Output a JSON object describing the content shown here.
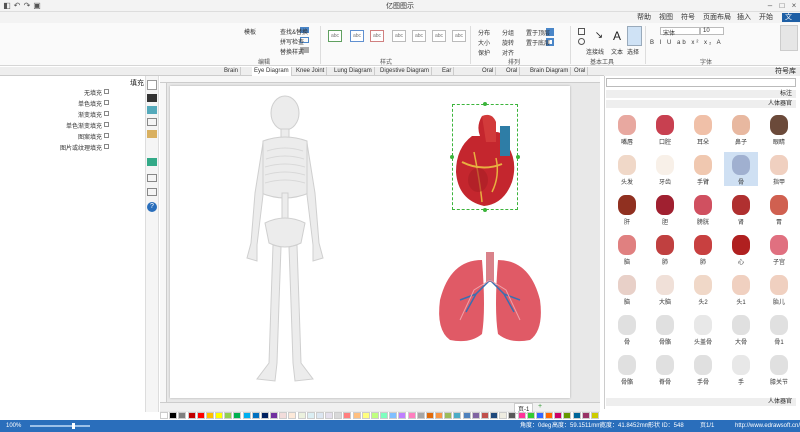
{
  "window": {
    "title": "亿图图示"
  },
  "menu": {
    "items": [
      "文件",
      "开始",
      "插入",
      "页面布局",
      "符号",
      "视图",
      "帮助"
    ],
    "active": 0
  },
  "ribbon": {
    "groups": [
      "文件",
      "字体",
      "基本工具",
      "排列",
      "样式",
      "编辑"
    ],
    "font": {
      "name": "宋体",
      "size": "10"
    },
    "tools": [
      "选择",
      "文本",
      "连接线"
    ],
    "arrange": [
      "置于顶层",
      "置于底层",
      "分组",
      "旋转",
      "对齐",
      "分布",
      "大小",
      "保护",
      "置于顶层"
    ],
    "edit": [
      "查找&替换",
      "拼写检查",
      "替换样式",
      "模板"
    ],
    "style_label": "abc"
  },
  "tabs": [
    "Oral",
    "Brain Diagram",
    "Oral",
    "Oral",
    "Ear",
    "Digestive Diagram",
    "Lung Diagram",
    "Knee Joint",
    "Eye Diagram",
    "Brain"
  ],
  "library": {
    "title": "符号库",
    "search_placeholder": "",
    "section1": "标注",
    "section2": "人体器官",
    "items": [
      {
        "label": "眼睛",
        "color": "#6b4a3a"
      },
      {
        "label": "鼻子",
        "color": "#e8b8a0"
      },
      {
        "label": "耳朵",
        "color": "#f0c0a8"
      },
      {
        "label": "口腔",
        "color": "#c84050"
      },
      {
        "label": "嘴唇",
        "color": "#e8a8a0"
      },
      {
        "label": "指甲",
        "color": "#f0d0c0"
      },
      {
        "label": "骨",
        "color": "#a0b0d0"
      },
      {
        "label": "手臂",
        "color": "#f0c8b0"
      },
      {
        "label": "牙齿",
        "color": "#f8f0e8"
      },
      {
        "label": "头发",
        "color": "#f0d8c8"
      },
      {
        "label": "胃",
        "color": "#d06050"
      },
      {
        "label": "肾",
        "color": "#b03030"
      },
      {
        "label": "膀胱",
        "color": "#d05060"
      },
      {
        "label": "胆",
        "color": "#a02030"
      },
      {
        "label": "肝",
        "color": "#903020"
      },
      {
        "label": "子宫",
        "color": "#e07080"
      },
      {
        "label": "心",
        "color": "#b02020"
      },
      {
        "label": "肺",
        "color": "#c84040"
      },
      {
        "label": "肺",
        "color": "#c04040"
      },
      {
        "label": "脑",
        "color": "#e08080"
      },
      {
        "label": "胎儿",
        "color": "#f0d0c0"
      },
      {
        "label": "头1",
        "color": "#f0d0c0"
      },
      {
        "label": "头2",
        "color": "#f0d8c8"
      },
      {
        "label": "大脑",
        "color": "#f0e0d8"
      },
      {
        "label": "脑",
        "color": "#e8d0c8"
      },
      {
        "label": "骨1",
        "color": "#e0e0e0"
      },
      {
        "label": "大骨",
        "color": "#e0e0e0"
      },
      {
        "label": "头盖骨",
        "color": "#e8e8e8"
      },
      {
        "label": "骨骼",
        "color": "#e0e0e0"
      },
      {
        "label": "骨",
        "color": "#e0e0e0"
      },
      {
        "label": "膝关节",
        "color": "#e0e0e0"
      },
      {
        "label": "手",
        "color": "#e8e8e8"
      },
      {
        "label": "手骨",
        "color": "#e0e0e0"
      },
      {
        "label": "脊骨",
        "color": "#e0e0e0"
      },
      {
        "label": "骨骼",
        "color": "#e0e0e0"
      }
    ],
    "footer": "人体器官"
  },
  "left_panel": {
    "title": "填充",
    "items": [
      "无填充",
      "单色填充",
      "渐变填充",
      "单色渐变填充",
      "图案填充",
      "图片或纹理填充"
    ]
  },
  "page_tab": "页-1",
  "palette": [
    "#ffffff",
    "#000000",
    "#7f7f7f",
    "#c00000",
    "#ff0000",
    "#ffc000",
    "#ffff00",
    "#92d050",
    "#00b050",
    "#00b0f0",
    "#0070c0",
    "#002060",
    "#7030a0",
    "#f2dcdb",
    "#fde9d9",
    "#ebf1de",
    "#dbeef3",
    "#dce6f1",
    "#e4dfec",
    "#d9d9d9",
    "#ff7f7f",
    "#ffbf7f",
    "#ffff7f",
    "#bfff7f",
    "#7fffbf",
    "#7fbfff",
    "#bf7fff",
    "#ff7fbf",
    "#a6a6a6",
    "#e26b0a",
    "#f79646",
    "#9bbb59",
    "#4bacc6",
    "#4f81bd",
    "#8064a2",
    "#c0504d",
    "#1f497d",
    "#eeece1",
    "#595959",
    "#ff3399",
    "#33cc33",
    "#3366ff",
    "#ff6600",
    "#cc0066",
    "#669900",
    "#006699",
    "#993366",
    "#cccc00"
  ],
  "status": {
    "url": "http://www.edrawsoft.cn/",
    "page": "页1/1",
    "shape": "形状 ID：548",
    "width": "宽度：41.8452mm",
    "height": "高度：59.1511mm",
    "angle": "角度：0deg",
    "zoom": "100%"
  }
}
